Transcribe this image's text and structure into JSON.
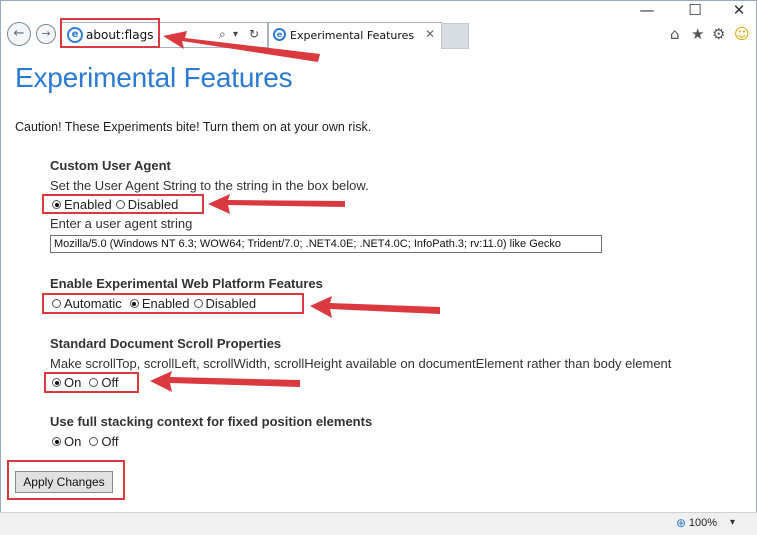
{
  "window": {
    "minimize": "—",
    "maximize": "☐",
    "close": "✕"
  },
  "nav": {
    "back": "←",
    "forward": "→"
  },
  "address": {
    "url": "about:flags",
    "search_icon": "⌕",
    "dropdown_icon": "▾",
    "refresh_icon": "↻"
  },
  "tab": {
    "title": "Experimental Features",
    "close": "✕"
  },
  "toolbar_icons": {
    "home": "⌂",
    "favorites": "★",
    "settings": "⚙",
    "feedback": "☺"
  },
  "page": {
    "heading": "Experimental Features",
    "caution": "Caution! These Experiments bite! Turn them on at your own risk.",
    "sections": [
      {
        "title": "Custom User Agent",
        "description": "Set the User Agent String to the string in the box below.",
        "options": [
          "Enabled",
          "Disabled"
        ],
        "selected": "Enabled",
        "input_label": "Enter a user agent string",
        "input_value": "Mozilla/5.0 (Windows NT 6.3; WOW64; Trident/7.0; .NET4.0E; .NET4.0C; InfoPath.3; rv:11.0) like Gecko"
      },
      {
        "title": "Enable Experimental Web Platform Features",
        "options": [
          "Automatic",
          "Enabled",
          "Disabled"
        ],
        "selected": "Enabled"
      },
      {
        "title": "Standard Document Scroll Properties",
        "description": "Make scrollTop, scrollLeft, scrollWidth, scrollHeight available on documentElement rather than body element",
        "options": [
          "On",
          "Off"
        ],
        "selected": "On"
      },
      {
        "title": "Use full stacking context for fixed position elements",
        "options": [
          "On",
          "Off"
        ],
        "selected": "On"
      }
    ],
    "apply_button": "Apply Changes"
  },
  "status": {
    "zoom": "100%",
    "zoom_dropdown": "▾"
  },
  "colors": {
    "heading": "#2b7bd3",
    "annotation": "#d9393f"
  }
}
